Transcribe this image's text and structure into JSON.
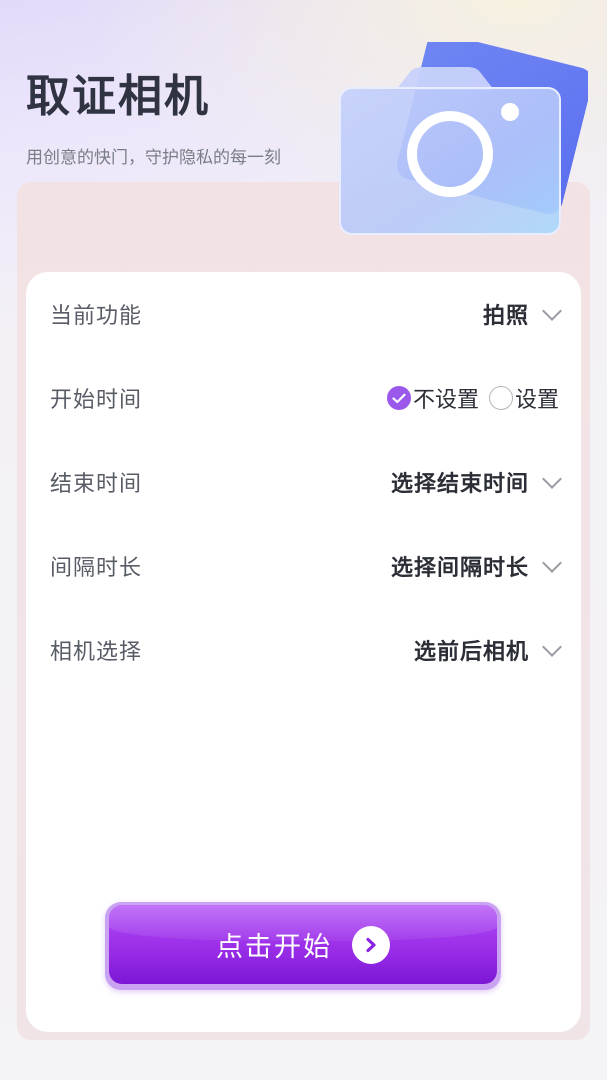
{
  "header": {
    "title": "取证相机",
    "subtitle": "用创意的快门，守护隐私的每一刻"
  },
  "settings": {
    "function": {
      "label": "当前功能",
      "value": "拍照"
    },
    "start_time": {
      "label": "开始时间",
      "options": [
        {
          "label": "不设置",
          "checked": true
        },
        {
          "label": "设置",
          "checked": false
        }
      ]
    },
    "end_time": {
      "label": "结束时间",
      "value": "选择结束时间"
    },
    "interval": {
      "label": "间隔时长",
      "value": "选择间隔时长"
    },
    "camera": {
      "label": "相机选择",
      "value": "选前后相机"
    }
  },
  "start_button": {
    "label": "点击开始"
  },
  "icons": {
    "hero": "camera-illustration-icon",
    "dropdown": "chevron-down-icon",
    "start": "chevron-right-icon",
    "checked": "check-icon"
  },
  "colors": {
    "accent": "#9b59ec",
    "button": "#9a2ee8",
    "title": "#2f3342"
  }
}
